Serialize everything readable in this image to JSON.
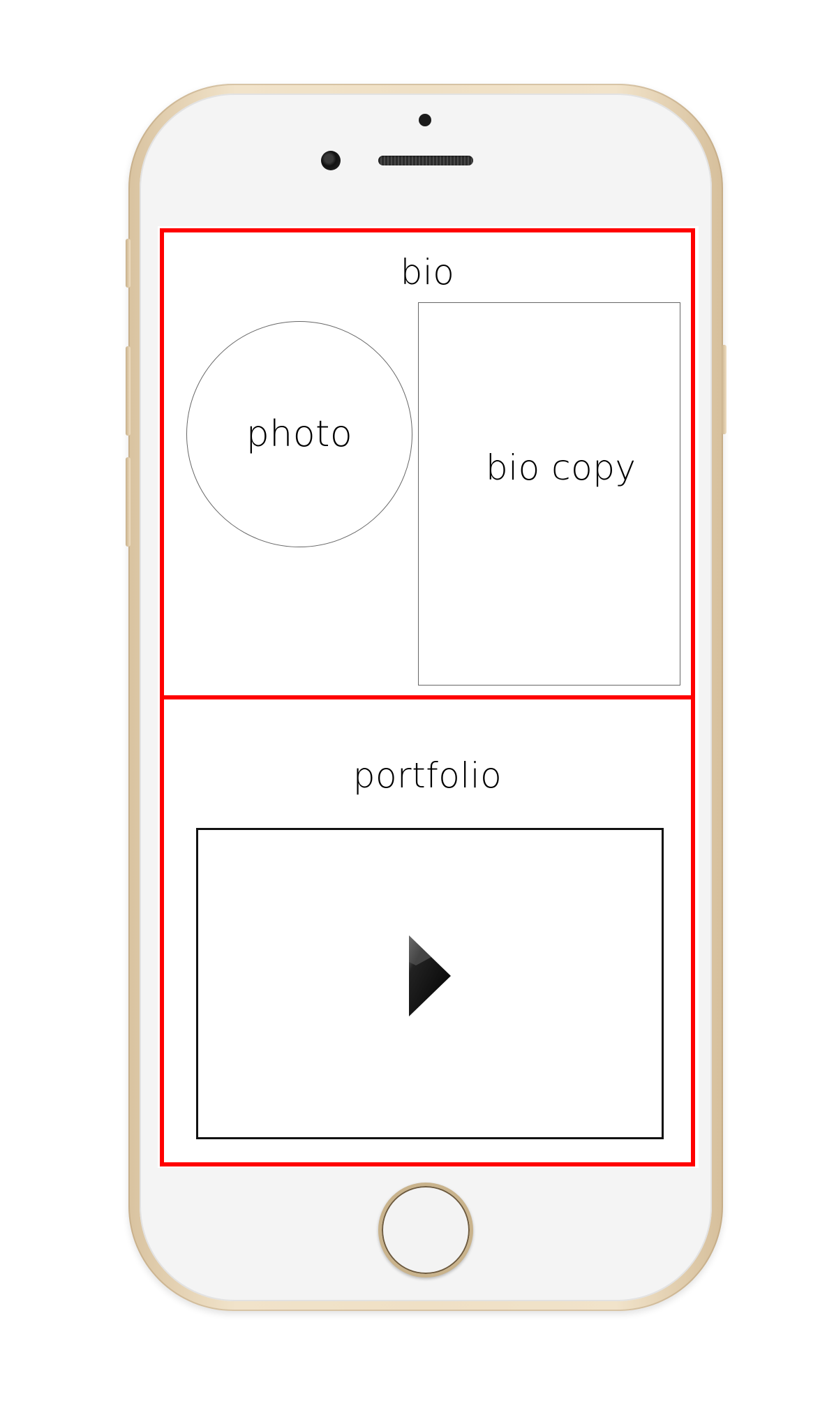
{
  "bio": {
    "title": "bio",
    "photo_label": "photo",
    "copy_label": "bio copy"
  },
  "portfolio": {
    "title": "portfolio",
    "video_icon": "play-icon"
  },
  "colors": {
    "section_outline": "#ff0000",
    "phone_body": "#efe0c5",
    "phone_face": "#f4f4f4"
  }
}
